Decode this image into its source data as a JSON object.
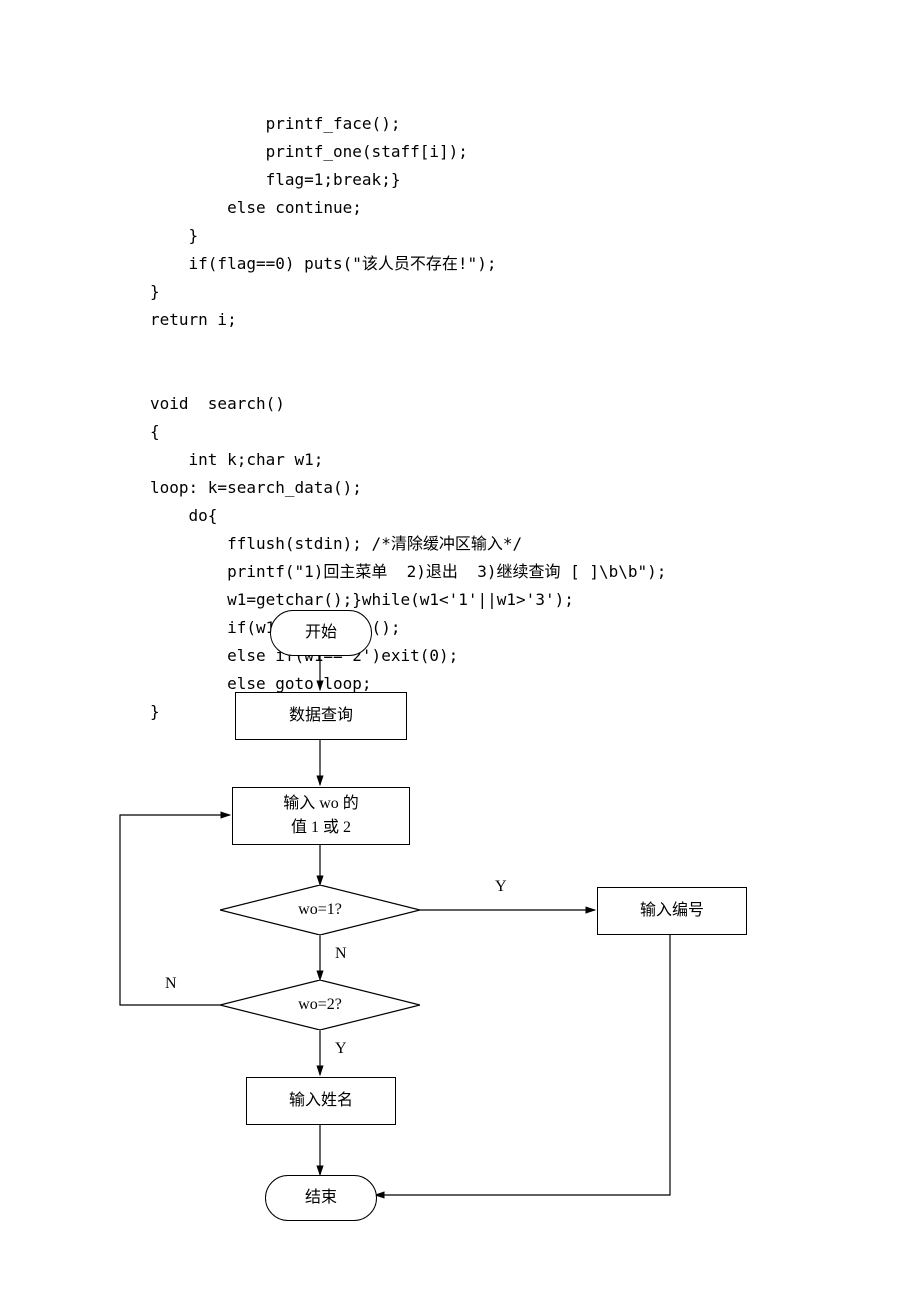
{
  "code": {
    "l1": "            printf_face();",
    "l2": "            printf_one(staff[i]);",
    "l3": "            flag=1;break;}",
    "l4": "        else continue;",
    "l5": "    }",
    "l6": "    if(flag==0) puts(\"该人员不存在!\");",
    "l7": "}",
    "l8": "return i;",
    "l9": "",
    "l10": "",
    "l11": "void  search()",
    "l12": "{",
    "l13": "    int k;char w1;",
    "l14": "loop: k=search_data();",
    "l15": "    do{",
    "l16": "        fflush(stdin); /*清除缓冲区输入*/",
    "l17": "        printf(\"1)回主菜单  2)退出  3)继续查询 [ ]\\b\\b\");",
    "l18": "        w1=getchar();}while(w1<'1'||w1>'3');",
    "l19": "        if(w1=='1')menu();",
    "l20": "        else if(w1=='2')exit(0);",
    "l21": "        else goto loop;",
    "l22": "}"
  },
  "flow": {
    "start": "开始",
    "query": "数据查询",
    "input_wo_l1": "输入 wo 的",
    "input_wo_l2": "值   1 或 2",
    "wo1": "wo=1?",
    "wo2": "wo=2?",
    "input_num": "输入编号",
    "input_name": "输入姓名",
    "end": "结束",
    "y1": "Y",
    "n1": "N",
    "y2": "Y",
    "n2": "N"
  },
  "chart_data": {
    "type": "flowchart",
    "nodes": [
      {
        "id": "start",
        "type": "terminator",
        "label": "开始"
      },
      {
        "id": "query",
        "type": "process",
        "label": "数据查询"
      },
      {
        "id": "input_wo",
        "type": "process",
        "label": "输入 wo 的值 1 或 2"
      },
      {
        "id": "d1",
        "type": "decision",
        "label": "wo=1?"
      },
      {
        "id": "d2",
        "type": "decision",
        "label": "wo=2?"
      },
      {
        "id": "input_num",
        "type": "process",
        "label": "输入编号"
      },
      {
        "id": "input_name",
        "type": "process",
        "label": "输入姓名"
      },
      {
        "id": "end",
        "type": "terminator",
        "label": "结束"
      }
    ],
    "edges": [
      {
        "from": "start",
        "to": "query"
      },
      {
        "from": "query",
        "to": "input_wo"
      },
      {
        "from": "input_wo",
        "to": "d1"
      },
      {
        "from": "d1",
        "to": "input_num",
        "label": "Y"
      },
      {
        "from": "d1",
        "to": "d2",
        "label": "N"
      },
      {
        "from": "d2",
        "to": "input_wo",
        "label": "N"
      },
      {
        "from": "d2",
        "to": "input_name",
        "label": "Y"
      },
      {
        "from": "input_name",
        "to": "end"
      },
      {
        "from": "input_num",
        "to": "end"
      }
    ]
  }
}
